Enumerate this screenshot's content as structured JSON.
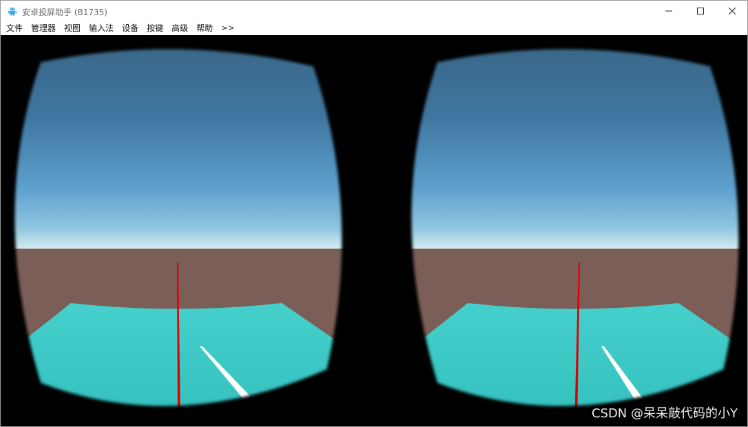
{
  "window": {
    "title": "安卓投屏助手 (B1735)",
    "controls": {
      "minimize": "minimize-icon",
      "maximize": "maximize-icon",
      "close": "close-icon"
    }
  },
  "menu": {
    "items": [
      "文件",
      "管理器",
      "视图",
      "输入法",
      "设备",
      "按键",
      "高级",
      "帮助",
      ">>"
    ]
  },
  "scene": {
    "colors": {
      "sky_top": "#3c6a8c",
      "sky_mid": "#5a96c3",
      "horizon_glow": "#eef6f8",
      "ground": "#7a5e57",
      "floor": "#3dc7c4",
      "laser": "#e00000",
      "streak": "#ffffff",
      "background": "#000000"
    }
  },
  "watermark": "CSDN @呆呆敲代码的小Y"
}
